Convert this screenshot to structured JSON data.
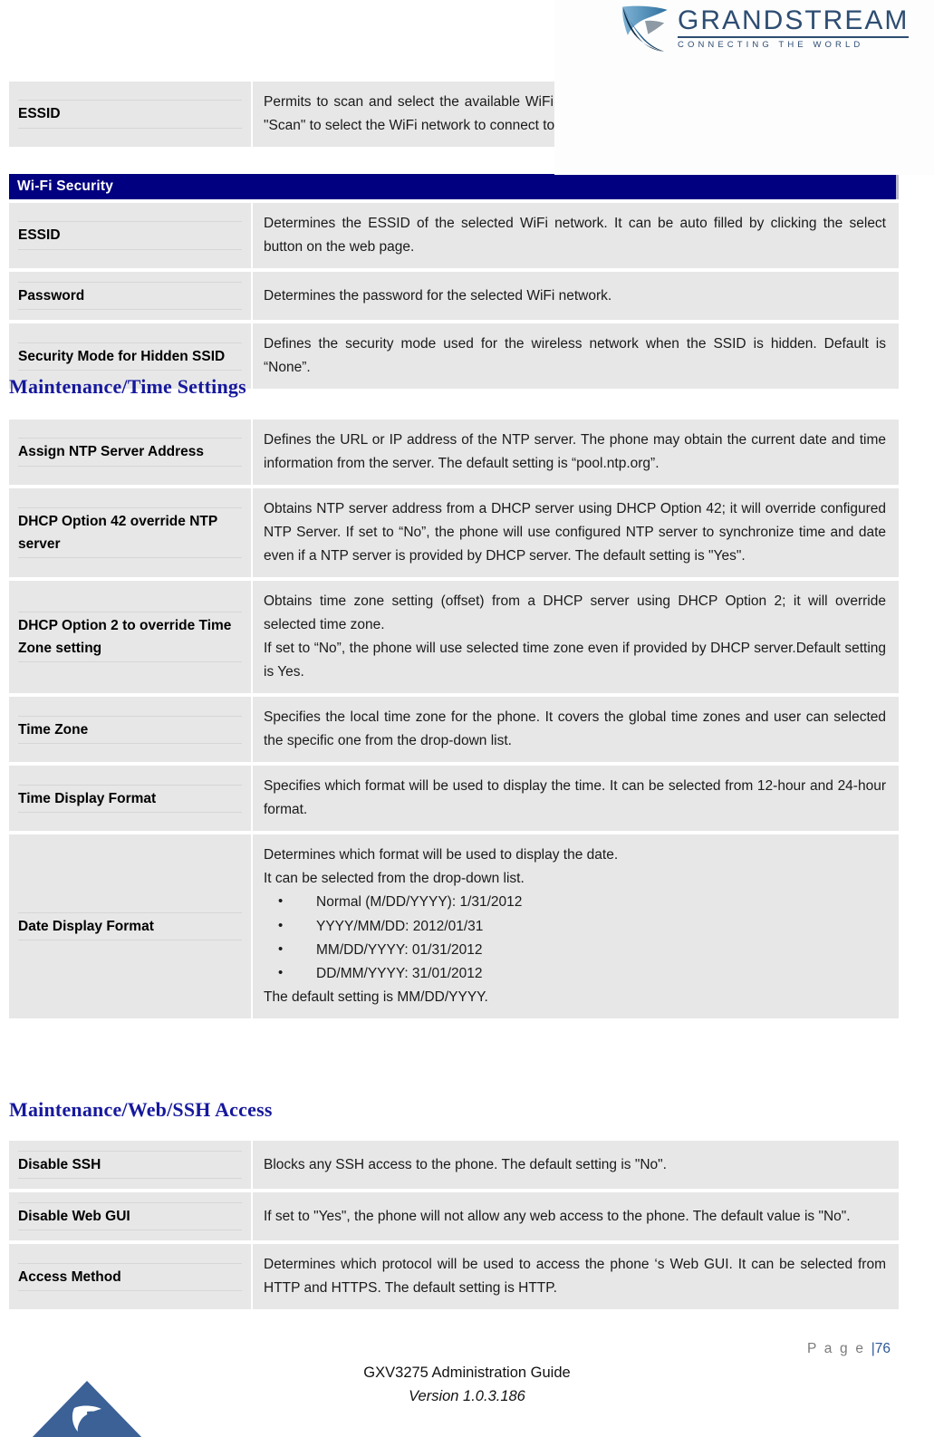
{
  "header": {
    "logo_name": "grandstream-logo",
    "brand": "GRANDSTREAM",
    "tagline": "CONNECTING THE WORLD",
    "brand_color": "#2e4d72"
  },
  "colors": {
    "section_bar": "#000080",
    "heading": "#16189c",
    "row_bg": "#e7e7e7",
    "page_number": "#2b5797"
  },
  "tables": [
    {
      "id": "wifi-table-top",
      "rows": [
        {
          "label": "ESSID",
          "paragraphs": [
            "Permits to scan and select the available WiFi network when the WiFi feature is enabled. Click on \"Scan\" to select the WiFi network to connect to. The ESSID will be auto filled."
          ]
        }
      ]
    },
    {
      "id": "wifi-security-table",
      "section_bar": "Wi-Fi Security",
      "rows": [
        {
          "label": "ESSID",
          "paragraphs": [
            "Determines the ESSID of the selected WiFi network. It can be auto filled by clicking the select button on the web page."
          ]
        },
        {
          "label": "Password",
          "paragraphs": [
            "Determines the password for the selected WiFi network."
          ]
        },
        {
          "label": "Security Mode for Hidden SSID",
          "paragraphs": [
            "Defines the security mode used for the wireless network when the SSID is hidden. Default is “None”."
          ]
        }
      ]
    },
    {
      "id": "time-settings-table",
      "heading": "Maintenance/Time Settings",
      "rows": [
        {
          "label": "Assign NTP Server Address",
          "paragraphs": [
            "Defines the URL or IP address of the NTP server. The phone may obtain the current date and time information from the server. The default setting is “pool.ntp.org”."
          ]
        },
        {
          "label": "DHCP Option 42 override NTP server",
          "paragraphs": [
            "Obtains NTP server address from a DHCP server using DHCP Option 42; it will override configured NTP Server. If set to “No”, the phone will use configured NTP server to synchronize time and date even if a NTP server is provided by DHCP server. The default setting is \"Yes\"."
          ]
        },
        {
          "label": "DHCP Option 2 to override Time Zone setting",
          "paragraphs": [
            "Obtains time zone setting (offset) from a DHCP server using DHCP Option 2; it will override selected time zone.",
            "If set to “No”, the phone will use selected time zone even if provided by DHCP server.Default setting is Yes."
          ]
        },
        {
          "label": "Time Zone",
          "paragraphs": [
            "Specifies the local time zone for the phone. It covers the global time zones and user can selected the specific one from the drop-down list."
          ]
        },
        {
          "label": "Time Display Format",
          "paragraphs": [
            "Specifies which format will be used to display the time. It can be selected from 12-hour and 24-hour format."
          ]
        },
        {
          "label": "Date Display Format",
          "paragraphs": [
            "Determines which format will be used to display the date.",
            "It can be selected from the drop-down list."
          ],
          "bullets": [
            "Normal (M/DD/YYYY): 1/31/2012",
            "YYYY/MM/DD: 2012/01/31",
            "MM/DD/YYYY: 01/31/2012",
            "DD/MM/YYYY: 31/01/2012"
          ],
          "paragraphs_after": [
            "The default setting is MM/DD/YYYY."
          ]
        }
      ]
    },
    {
      "id": "web-ssh-table",
      "heading": "Maintenance/Web/SSH Access",
      "rows": [
        {
          "label": "Disable SSH",
          "paragraphs": [
            "Blocks any SSH access to the phone. The default setting is \"No\"."
          ]
        },
        {
          "label": "Disable Web GUI",
          "paragraphs": [
            "If set to \"Yes\", the phone will not allow any web access to the phone. The default value is \"No\"."
          ]
        },
        {
          "label": "Access Method",
          "paragraphs": [
            "Determines which protocol will be used to access the phone ‘s Web GUI. It can be selected from HTTP and HTTPS. The default setting is HTTP."
          ]
        }
      ]
    }
  ],
  "footer": {
    "page_label": "P a g e ",
    "page_separator": "|",
    "page_number": "76",
    "guide_title": "GXV3275 Administration Guide",
    "version": "Version 1.0.3.186",
    "mark_name": "grandstream-triangle-mark"
  }
}
